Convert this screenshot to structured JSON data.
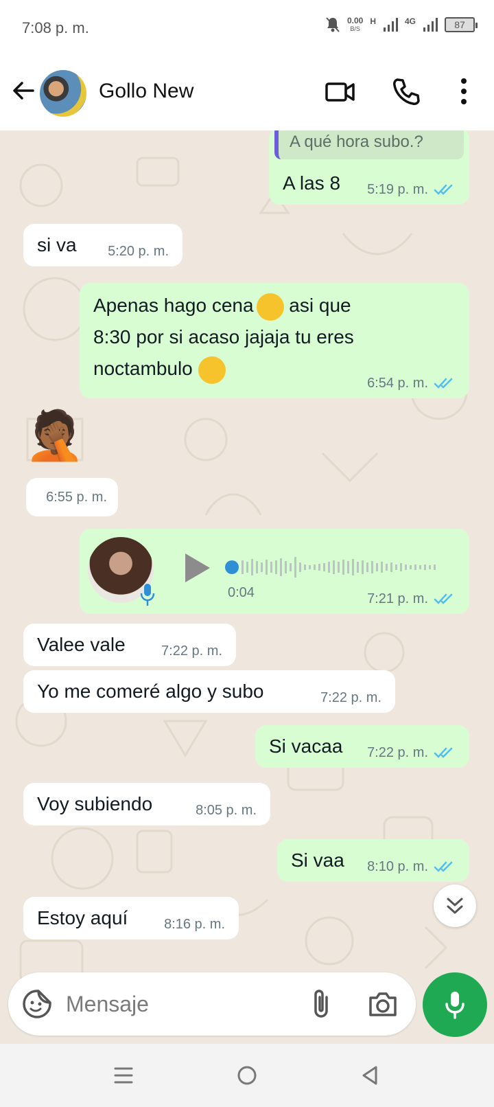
{
  "status_bar": {
    "time": "7:08 p. m.",
    "net_speed": "0.00",
    "net_unit": "B/S",
    "signal1_label": "H",
    "signal2_label": "4G",
    "battery": "87"
  },
  "header": {
    "contact_name": "Gollo New"
  },
  "messages": [
    {
      "quote": "A qué hora subo.?",
      "text": "A las 8",
      "time": "5:19 p. m."
    },
    {
      "text": "si va",
      "time": "5:20 p. m."
    },
    {
      "line1": "Apenas hago cena",
      "line1b": " asi que",
      "line2": "8:30 por si acaso jajaja tu eres",
      "line3": "noctambulo",
      "time": "6:54 p. m."
    },
    {
      "emoji": "🤦🏾",
      "time": "6:55 p. m."
    },
    {
      "duration": "0:04",
      "time": "7:21 p. m."
    },
    {
      "text": "Valee vale",
      "time": "7:22 p. m."
    },
    {
      "text": "Yo me comeré algo y subo",
      "time": "7:22 p. m."
    },
    {
      "text": "Si vacaa",
      "time": "7:22 p. m."
    },
    {
      "text": "Voy subiendo",
      "time": "8:05 p. m."
    },
    {
      "text": "Si vaa",
      "time": "8:10 p. m."
    },
    {
      "text": "Estoy aquí",
      "time": "8:16 p. m."
    }
  ],
  "composer": {
    "placeholder": "Mensaje"
  },
  "colors": {
    "outgoing_bubble": "#d9fdd3",
    "incoming_bubble": "#ffffff",
    "chat_background": "#efe7dd",
    "read_ticks": "#53bdeb",
    "mic_button": "#1ea952"
  }
}
